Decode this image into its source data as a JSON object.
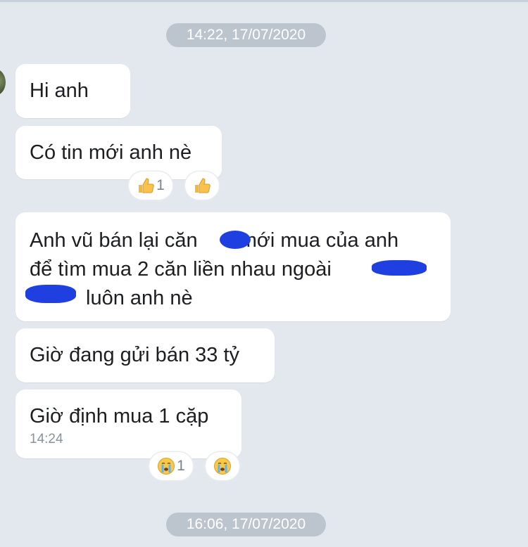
{
  "chat": {
    "date_separators": [
      "14:22, 17/07/2020",
      "16:06, 17/07/2020"
    ],
    "messages": [
      {
        "text": "Hi anh"
      },
      {
        "text": "Có tin mới anh nè"
      },
      {
        "line1_a": "Anh vũ bán lại căn",
        "line1_b": "mới mua của anh",
        "line2": "để tìm mua 2 căn liền nhau ngoài",
        "line3": "luôn anh nè"
      },
      {
        "text": "Giờ đang gửi bán 33 tỷ"
      },
      {
        "text": "Giờ định mua 1 cặp",
        "time": "14:24"
      }
    ],
    "reactions": [
      {
        "icon": "thumbs-up-icon",
        "count": "1"
      },
      {
        "icon": "thumbs-up-icon"
      },
      {
        "icon": "crying-face-icon",
        "count": "1"
      },
      {
        "icon": "crying-face-icon"
      }
    ]
  },
  "colors": {
    "background": "#e3e8ef",
    "bubble": "#ffffff",
    "pill": "#bcc4ce",
    "redaction": "#1f3fe0"
  }
}
